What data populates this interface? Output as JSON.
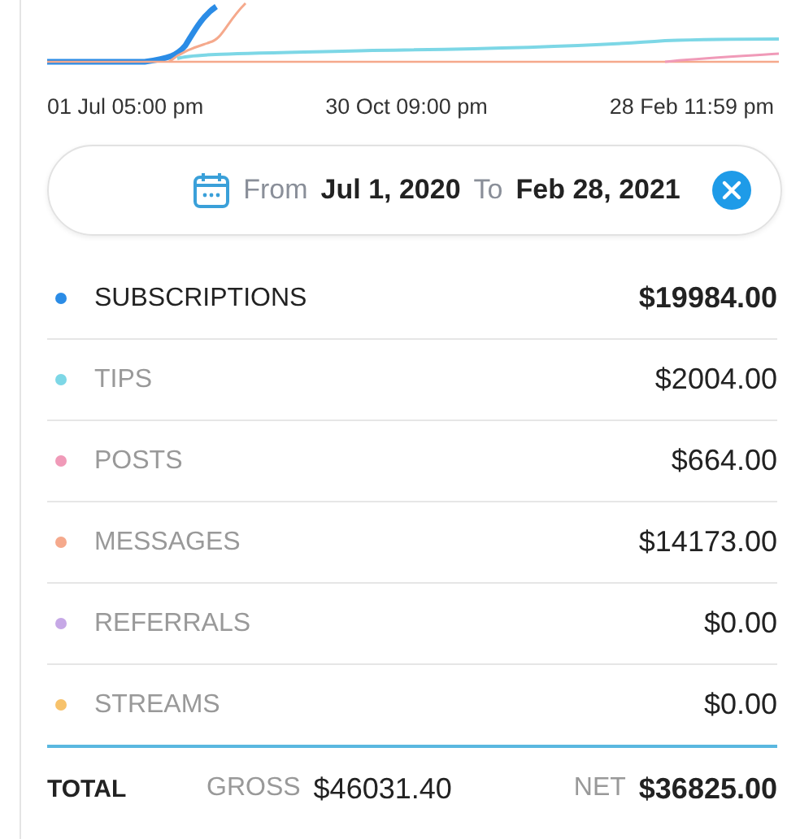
{
  "chart": {
    "x_labels": [
      "01 Jul 05:00 pm",
      "30 Oct 09:00 pm",
      "28 Feb 11:59 pm"
    ]
  },
  "date_range": {
    "from_label": "From",
    "from": "Jul 1, 2020",
    "to_label": "To",
    "to": "Feb 28, 2021"
  },
  "categories": [
    {
      "name": "SUBSCRIPTIONS",
      "amount": "$19984.00",
      "color": "#2b8ce6",
      "selected": true
    },
    {
      "name": "TIPS",
      "amount": "$2004.00",
      "color": "#7dd7e6",
      "selected": false
    },
    {
      "name": "POSTS",
      "amount": "$664.00",
      "color": "#f09ab8",
      "selected": false
    },
    {
      "name": "MESSAGES",
      "amount": "$14173.00",
      "color": "#f5a98c",
      "selected": false
    },
    {
      "name": "REFERRALS",
      "amount": "$0.00",
      "color": "#c6a8e6",
      "selected": false
    },
    {
      "name": "STREAMS",
      "amount": "$0.00",
      "color": "#f7c26b",
      "selected": false
    }
  ],
  "total": {
    "label": "TOTAL",
    "gross_label": "GROSS",
    "gross": "$46031.40",
    "net_label": "NET",
    "net": "$36825.00"
  }
}
